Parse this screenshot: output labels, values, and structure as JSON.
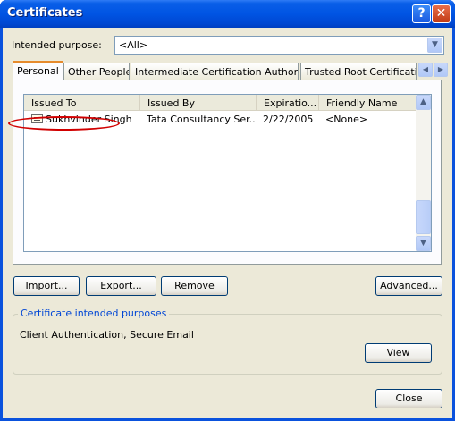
{
  "window": {
    "title": "Certificates",
    "help_glyph": "?",
    "close_glyph": "✕"
  },
  "purpose": {
    "label": "Intended purpose:",
    "value": "<All>"
  },
  "tabs": [
    {
      "label": "Personal",
      "active": true
    },
    {
      "label": "Other People",
      "active": false
    },
    {
      "label": "Intermediate Certification Authorities",
      "active": false
    },
    {
      "label": "Trusted Root Certification",
      "active": false
    }
  ],
  "list": {
    "columns": [
      "Issued To",
      "Issued By",
      "Expiratio...",
      "Friendly Name"
    ],
    "rows": [
      {
        "issued_to": "Sukhvinder Singh",
        "issued_by": "Tata Consultancy Ser...",
        "expiration": "2/22/2005",
        "friendly_name": "<None>",
        "icon": "certificate-icon"
      }
    ]
  },
  "buttons": {
    "import": "Import...",
    "export": "Export...",
    "remove": "Remove",
    "advanced": "Advanced...",
    "view": "View",
    "close": "Close"
  },
  "purposes_group": {
    "title": "Certificate intended purposes",
    "text": "Client Authentication, Secure Email"
  },
  "colors": {
    "titlebar": "#0054e3",
    "dialog_bg": "#ece9d8",
    "group_title": "#0046d5",
    "highlight_ellipse": "#d10000",
    "active_tab_accent": "#e68b2c"
  }
}
